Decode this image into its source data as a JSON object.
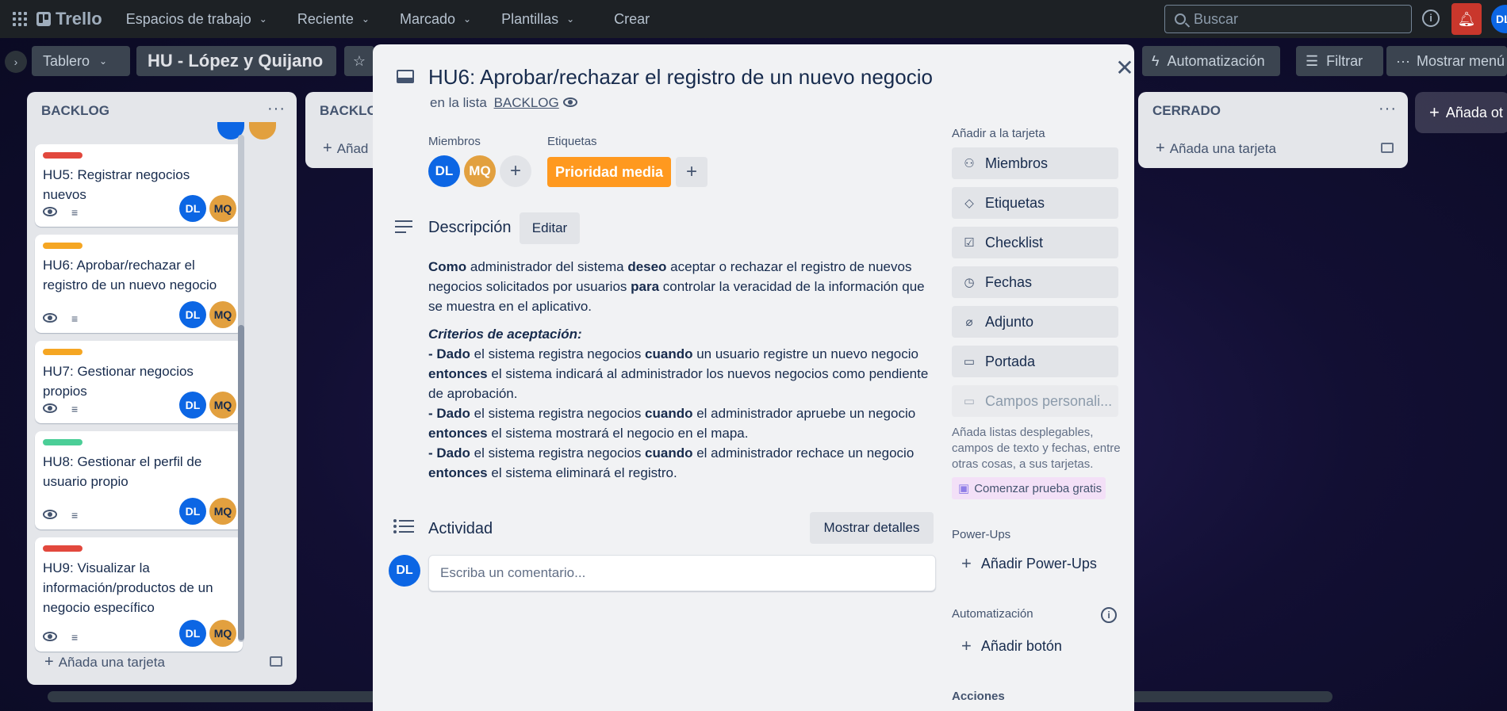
{
  "topbar": {
    "logo": "Trello",
    "nav": [
      {
        "label": "Espacios de trabajo"
      },
      {
        "label": "Reciente"
      },
      {
        "label": "Marcado"
      },
      {
        "label": "Plantillas"
      }
    ],
    "create_label": "Crear",
    "search_placeholder": "Buscar",
    "avatar": "DL"
  },
  "board_header": {
    "view_label": "Tablero",
    "board_title": "HU - López y Quijano",
    "automation_label": "Automatización",
    "filter_label": "Filtrar",
    "menu_label": "Mostrar menú"
  },
  "lists": {
    "backlog": {
      "title": "BACKLOG",
      "menu": "···",
      "add_card": "Añada una tarjeta",
      "cards": [
        {
          "title": "HU5: Registrar negocios nuevos",
          "label_color": "#e2483d",
          "members": [
            "DL",
            "MQ"
          ]
        },
        {
          "title": "HU6: Aprobar/rechazar el registro de un nuevo negocio",
          "label_color": "#f5a623",
          "members": [
            "DL",
            "MQ"
          ]
        },
        {
          "title": "HU7: Gestionar negocios propios",
          "label_color": "#f5a623",
          "members": [
            "DL",
            "MQ"
          ]
        },
        {
          "title": "HU8: Gestionar el perfil de usuario propio",
          "label_color": "#4bce97",
          "members": [
            "DL",
            "MQ"
          ]
        },
        {
          "title": "HU9: Visualizar la información/productos de un negocio específico",
          "label_color": "#e2483d",
          "members": [
            "DL",
            "MQ"
          ]
        }
      ]
    },
    "backlog2": {
      "title": "BACKLO",
      "add_card": "Añad"
    },
    "cerrado": {
      "title": "CERRADO",
      "menu": "···",
      "add_card": "Añada una tarjeta"
    },
    "add_list": "Añada ot"
  },
  "modal": {
    "title": "HU6: Aprobar/rechazar el registro de un nuevo negocio",
    "in_list_prefix": "en la lista",
    "list_name": "BACKLOG",
    "members_label": "Miembros",
    "members": [
      "DL",
      "MQ"
    ],
    "labels_label": "Etiquetas",
    "label_chip": "Prioridad media",
    "description_heading": "Descripción",
    "edit_label": "Editar",
    "description": {
      "p1": [
        {
          "t": "Como",
          "b": true
        },
        {
          "t": " administrador del sistema ",
          "b": false
        },
        {
          "t": "deseo",
          "b": true
        },
        {
          "t": " aceptar o rechazar el registro de nuevos negocios solicitados por usuarios ",
          "b": false
        },
        {
          "t": "para",
          "b": true
        },
        {
          "t": " controlar la veracidad de la información que se muestra en el aplicativo.",
          "b": false
        }
      ],
      "criteria_heading": "Criterios de aceptación:",
      "criteria": [
        [
          {
            "t": "- Dado",
            "b": true
          },
          {
            "t": " el sistema registra negocios ",
            "b": false
          },
          {
            "t": "cuando",
            "b": true
          },
          {
            "t": " un usuario registre un nuevo negocio ",
            "b": false
          },
          {
            "t": "entonces",
            "b": true
          },
          {
            "t": " el sistema indicará al administrador los nuevos negocios como pendiente de aprobación.",
            "b": false
          }
        ],
        [
          {
            "t": "- Dado",
            "b": true
          },
          {
            "t": " el sistema registra negocios ",
            "b": false
          },
          {
            "t": "cuando",
            "b": true
          },
          {
            "t": " el administrador apruebe un negocio ",
            "b": false
          },
          {
            "t": "entonces",
            "b": true
          },
          {
            "t": " el sistema mostrará el negocio en el mapa.",
            "b": false
          }
        ],
        [
          {
            "t": "- Dado",
            "b": true
          },
          {
            "t": " el sistema registra negocios ",
            "b": false
          },
          {
            "t": "cuando",
            "b": true
          },
          {
            "t": " el administrador rechace un negocio ",
            "b": false
          },
          {
            "t": "entonces",
            "b": true
          },
          {
            "t": " el sistema eliminará el registro.",
            "b": false
          }
        ]
      ]
    },
    "activity_heading": "Actividad",
    "show_details": "Mostrar detalles",
    "comment_avatar": "DL",
    "comment_placeholder": "Escriba un comentario...",
    "sidebar": {
      "add_heading": "Añadir a la tarjeta",
      "buttons": [
        {
          "label": "Miembros",
          "icon": "person-icon"
        },
        {
          "label": "Etiquetas",
          "icon": "tag-icon"
        },
        {
          "label": "Checklist",
          "icon": "checklist-icon"
        },
        {
          "label": "Fechas",
          "icon": "clock-icon"
        },
        {
          "label": "Adjunto",
          "icon": "paperclip-icon"
        },
        {
          "label": "Portada",
          "icon": "cover-icon"
        },
        {
          "label": "Campos personali...",
          "icon": "custom-fields-icon"
        }
      ],
      "note": "Añada listas desplegables, campos de texto y fechas, entre otras cosas, a sus tarjetas.",
      "trial_label": "Comenzar prueba gratis",
      "powerups_heading": "Power-Ups",
      "add_powerups": "Añadir Power-Ups",
      "automation_heading": "Automatización",
      "add_button": "Añadir botón",
      "actions_heading": "Acciones"
    }
  }
}
